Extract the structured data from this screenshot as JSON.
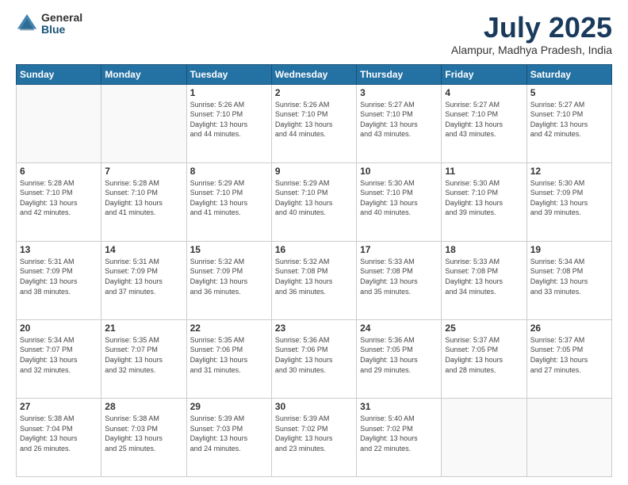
{
  "header": {
    "logo_general": "General",
    "logo_blue": "Blue",
    "title": "July 2025",
    "subtitle": "Alampur, Madhya Pradesh, India"
  },
  "days_of_week": [
    "Sunday",
    "Monday",
    "Tuesday",
    "Wednesday",
    "Thursday",
    "Friday",
    "Saturday"
  ],
  "weeks": [
    [
      {
        "day": "",
        "info": ""
      },
      {
        "day": "",
        "info": ""
      },
      {
        "day": "1",
        "info": "Sunrise: 5:26 AM\nSunset: 7:10 PM\nDaylight: 13 hours\nand 44 minutes."
      },
      {
        "day": "2",
        "info": "Sunrise: 5:26 AM\nSunset: 7:10 PM\nDaylight: 13 hours\nand 44 minutes."
      },
      {
        "day": "3",
        "info": "Sunrise: 5:27 AM\nSunset: 7:10 PM\nDaylight: 13 hours\nand 43 minutes."
      },
      {
        "day": "4",
        "info": "Sunrise: 5:27 AM\nSunset: 7:10 PM\nDaylight: 13 hours\nand 43 minutes."
      },
      {
        "day": "5",
        "info": "Sunrise: 5:27 AM\nSunset: 7:10 PM\nDaylight: 13 hours\nand 42 minutes."
      }
    ],
    [
      {
        "day": "6",
        "info": "Sunrise: 5:28 AM\nSunset: 7:10 PM\nDaylight: 13 hours\nand 42 minutes."
      },
      {
        "day": "7",
        "info": "Sunrise: 5:28 AM\nSunset: 7:10 PM\nDaylight: 13 hours\nand 41 minutes."
      },
      {
        "day": "8",
        "info": "Sunrise: 5:29 AM\nSunset: 7:10 PM\nDaylight: 13 hours\nand 41 minutes."
      },
      {
        "day": "9",
        "info": "Sunrise: 5:29 AM\nSunset: 7:10 PM\nDaylight: 13 hours\nand 40 minutes."
      },
      {
        "day": "10",
        "info": "Sunrise: 5:30 AM\nSunset: 7:10 PM\nDaylight: 13 hours\nand 40 minutes."
      },
      {
        "day": "11",
        "info": "Sunrise: 5:30 AM\nSunset: 7:10 PM\nDaylight: 13 hours\nand 39 minutes."
      },
      {
        "day": "12",
        "info": "Sunrise: 5:30 AM\nSunset: 7:09 PM\nDaylight: 13 hours\nand 39 minutes."
      }
    ],
    [
      {
        "day": "13",
        "info": "Sunrise: 5:31 AM\nSunset: 7:09 PM\nDaylight: 13 hours\nand 38 minutes."
      },
      {
        "day": "14",
        "info": "Sunrise: 5:31 AM\nSunset: 7:09 PM\nDaylight: 13 hours\nand 37 minutes."
      },
      {
        "day": "15",
        "info": "Sunrise: 5:32 AM\nSunset: 7:09 PM\nDaylight: 13 hours\nand 36 minutes."
      },
      {
        "day": "16",
        "info": "Sunrise: 5:32 AM\nSunset: 7:08 PM\nDaylight: 13 hours\nand 36 minutes."
      },
      {
        "day": "17",
        "info": "Sunrise: 5:33 AM\nSunset: 7:08 PM\nDaylight: 13 hours\nand 35 minutes."
      },
      {
        "day": "18",
        "info": "Sunrise: 5:33 AM\nSunset: 7:08 PM\nDaylight: 13 hours\nand 34 minutes."
      },
      {
        "day": "19",
        "info": "Sunrise: 5:34 AM\nSunset: 7:08 PM\nDaylight: 13 hours\nand 33 minutes."
      }
    ],
    [
      {
        "day": "20",
        "info": "Sunrise: 5:34 AM\nSunset: 7:07 PM\nDaylight: 13 hours\nand 32 minutes."
      },
      {
        "day": "21",
        "info": "Sunrise: 5:35 AM\nSunset: 7:07 PM\nDaylight: 13 hours\nand 32 minutes."
      },
      {
        "day": "22",
        "info": "Sunrise: 5:35 AM\nSunset: 7:06 PM\nDaylight: 13 hours\nand 31 minutes."
      },
      {
        "day": "23",
        "info": "Sunrise: 5:36 AM\nSunset: 7:06 PM\nDaylight: 13 hours\nand 30 minutes."
      },
      {
        "day": "24",
        "info": "Sunrise: 5:36 AM\nSunset: 7:05 PM\nDaylight: 13 hours\nand 29 minutes."
      },
      {
        "day": "25",
        "info": "Sunrise: 5:37 AM\nSunset: 7:05 PM\nDaylight: 13 hours\nand 28 minutes."
      },
      {
        "day": "26",
        "info": "Sunrise: 5:37 AM\nSunset: 7:05 PM\nDaylight: 13 hours\nand 27 minutes."
      }
    ],
    [
      {
        "day": "27",
        "info": "Sunrise: 5:38 AM\nSunset: 7:04 PM\nDaylight: 13 hours\nand 26 minutes."
      },
      {
        "day": "28",
        "info": "Sunrise: 5:38 AM\nSunset: 7:03 PM\nDaylight: 13 hours\nand 25 minutes."
      },
      {
        "day": "29",
        "info": "Sunrise: 5:39 AM\nSunset: 7:03 PM\nDaylight: 13 hours\nand 24 minutes."
      },
      {
        "day": "30",
        "info": "Sunrise: 5:39 AM\nSunset: 7:02 PM\nDaylight: 13 hours\nand 23 minutes."
      },
      {
        "day": "31",
        "info": "Sunrise: 5:40 AM\nSunset: 7:02 PM\nDaylight: 13 hours\nand 22 minutes."
      },
      {
        "day": "",
        "info": ""
      },
      {
        "day": "",
        "info": ""
      }
    ]
  ]
}
